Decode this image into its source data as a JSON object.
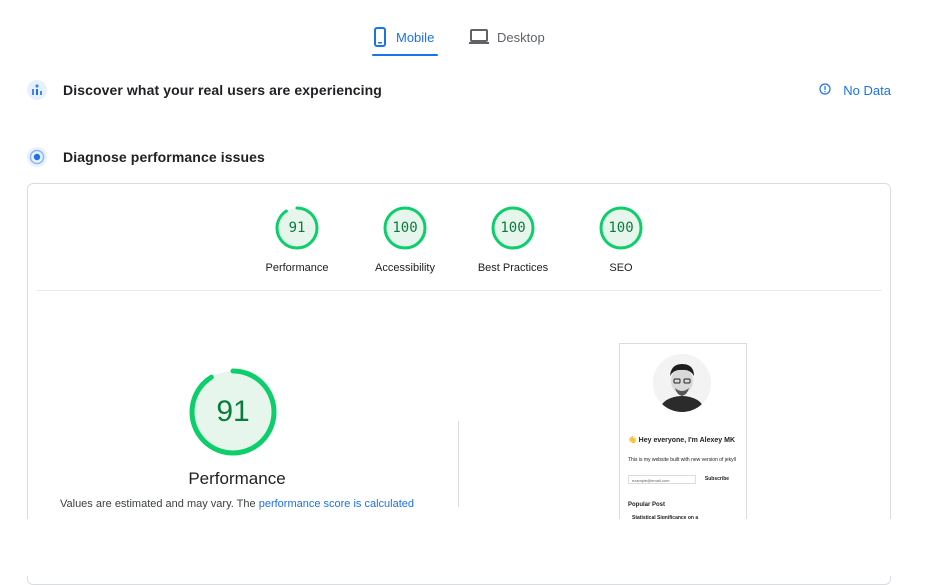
{
  "tabs": [
    {
      "label": "Mobile",
      "icon": "phone-icon",
      "active": true
    },
    {
      "label": "Desktop",
      "icon": "laptop-icon",
      "active": false
    }
  ],
  "real_users": {
    "title": "Discover what your real users are experiencing",
    "icon": "users-chart-icon",
    "status": "No Data",
    "status_icon": "info-icon"
  },
  "diagnose": {
    "title": "Diagnose performance issues",
    "icon": "target-icon"
  },
  "scores": [
    {
      "label": "Performance",
      "value": "91"
    },
    {
      "label": "Accessibility",
      "value": "100"
    },
    {
      "label": "Best Practices",
      "value": "100"
    },
    {
      "label": "SEO",
      "value": "100"
    }
  ],
  "main_score": {
    "value": "91",
    "label": "Performance",
    "note_prefix": "Values are estimated and may vary. The ",
    "note_link": "performance score is calculated"
  },
  "preview": {
    "heading": "👋 Hey everyone, I'm Alexey MK",
    "subtext": "This is my website built with new version of jekyll",
    "input_placeholder": "example@email.com",
    "button": "Subscribe",
    "popular": "Popular Post",
    "post": "Statistical Significance on a"
  },
  "colors": {
    "accent": "#1a73e8",
    "pass": "#0cce6b",
    "pass_text": "#0a7c3b",
    "pass_bg": "#e6f6ec"
  }
}
